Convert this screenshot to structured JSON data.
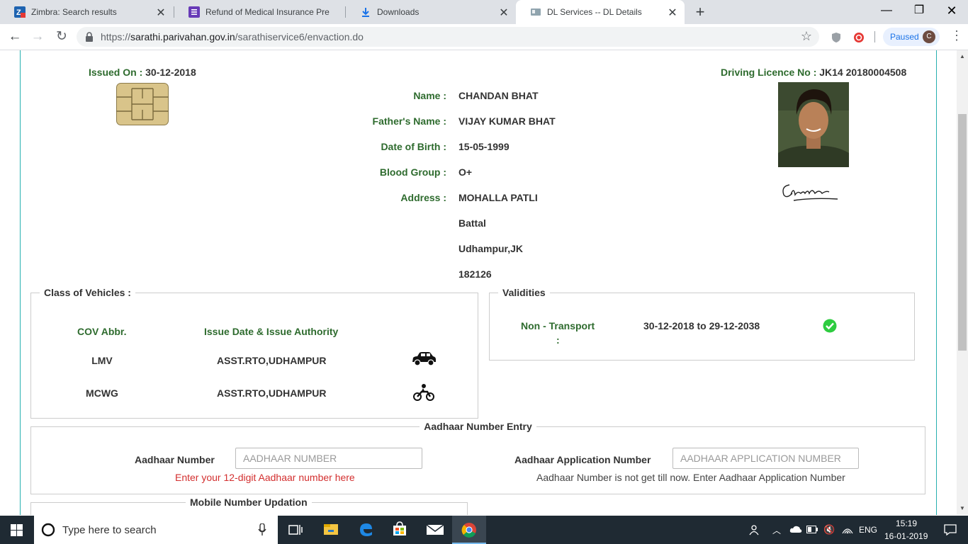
{
  "browser": {
    "tabs": [
      {
        "title": "Zimbra: Search results"
      },
      {
        "title": "Refund of Medical Insurance Pre"
      },
      {
        "title": "Downloads"
      },
      {
        "title": "DL Services -- DL Details"
      }
    ],
    "url_prefix": "https://",
    "url_host": "sarathi.parivahan.gov.in",
    "url_path": "/sarathiservice6/envaction.do",
    "paused_label": "Paused",
    "profile_initial": "C"
  },
  "licence": {
    "issued_on_label": "Issued On :",
    "issued_on": "30-12-2018",
    "dl_no_label": "Driving Licence No :",
    "dl_no": "JK14 20180004508",
    "fields": [
      {
        "label": "Name :",
        "value": "CHANDAN BHAT"
      },
      {
        "label": "Father's Name :",
        "value": "VIJAY KUMAR BHAT"
      },
      {
        "label": "Date of Birth :",
        "value": "15-05-1999"
      },
      {
        "label": "Blood Group :",
        "value": "O+"
      },
      {
        "label": "Address :",
        "value": "MOHALLA PATLI"
      }
    ],
    "address_lines": [
      "Battal",
      "Udhampur,JK",
      "182126"
    ],
    "signature": "Chanda"
  },
  "vehicle_classes": {
    "legend": "Class of Vehicles :",
    "headers": [
      "COV Abbr.",
      "Issue Date & Issue Authority"
    ],
    "rows": [
      {
        "abbr": "LMV",
        "authority": "ASST.RTO,UDHAMPUR",
        "icon": "car-icon"
      },
      {
        "abbr": "MCWG",
        "authority": "ASST.RTO,UDHAMPUR",
        "icon": "motorcycle-icon"
      }
    ]
  },
  "validities": {
    "legend": "Validities",
    "label": "Non - Transport",
    "colon": ":",
    "range": "30-12-2018 to 29-12-2038",
    "status_icon": "check-circle-icon"
  },
  "aadhaar": {
    "legend": "Aadhaar Number Entry",
    "number_label": "Aadhaar Number",
    "number_placeholder": "AADHAAR NUMBER",
    "number_hint": "Enter your 12-digit Aadhaar number here",
    "app_label": "Aadhaar Application Number",
    "app_placeholder": "AADHAAR APPLICATION NUMBER",
    "app_hint": "Aadhaar Number is not get till now. Enter Aadhaar Application Number"
  },
  "mobile": {
    "legend": "Mobile Number Updation"
  },
  "taskbar": {
    "search_placeholder": "Type here to search",
    "language": "ENG",
    "time": "15:19",
    "date": "16-01-2019"
  },
  "colors": {
    "label_green": "#2e6b2e",
    "hint_red": "#d32f2f",
    "frame_teal": "#27b0b0",
    "check_green": "#2ecc40"
  }
}
